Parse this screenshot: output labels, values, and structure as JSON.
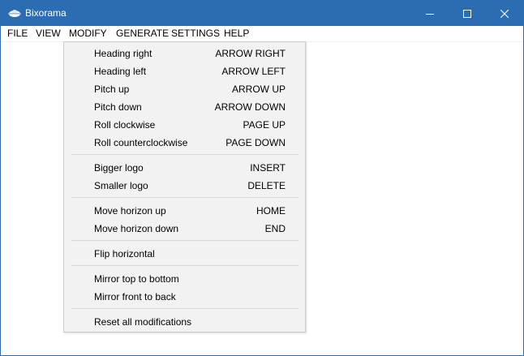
{
  "window": {
    "title": "Bixorama",
    "accent_color": "#2b6cb3"
  },
  "menubar": {
    "items": [
      "FILE",
      "VIEW",
      "MODIFY",
      "GENERATE",
      "SETTINGS",
      "HELP"
    ],
    "open_menu": "MODIFY"
  },
  "modify_menu": {
    "groups": [
      [
        {
          "label": "Heading right",
          "shortcut": "ARROW RIGHT"
        },
        {
          "label": "Heading left",
          "shortcut": "ARROW LEFT"
        },
        {
          "label": "Pitch up",
          "shortcut": "ARROW UP"
        },
        {
          "label": "Pitch down",
          "shortcut": "ARROW DOWN"
        },
        {
          "label": "Roll clockwise",
          "shortcut": "PAGE UP"
        },
        {
          "label": "Roll counterclockwise",
          "shortcut": "PAGE DOWN"
        }
      ],
      [
        {
          "label": "Bigger logo",
          "shortcut": "INSERT"
        },
        {
          "label": "Smaller logo",
          "shortcut": "DELETE"
        }
      ],
      [
        {
          "label": "Move horizon up",
          "shortcut": "HOME"
        },
        {
          "label": "Move horizon down",
          "shortcut": "END"
        }
      ],
      [
        {
          "label": "Flip horizontal",
          "shortcut": ""
        }
      ],
      [
        {
          "label": "Mirror top to bottom",
          "shortcut": ""
        },
        {
          "label": "Mirror front to back",
          "shortcut": ""
        }
      ],
      [
        {
          "label": "Reset all modifications",
          "shortcut": ""
        }
      ]
    ]
  },
  "icons": {
    "app": "app-logo-icon",
    "minimize": "minimize-icon",
    "maximize": "maximize-icon",
    "close": "close-icon"
  }
}
